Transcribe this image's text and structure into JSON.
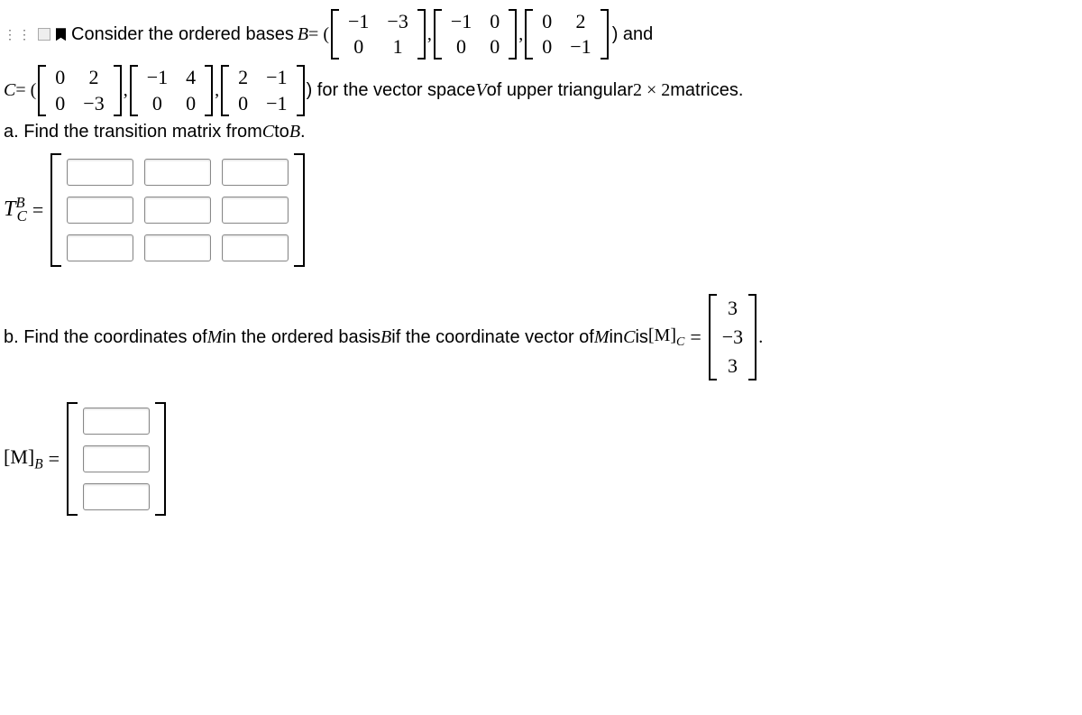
{
  "intro": {
    "lead": "Consider the ordered bases ",
    "B_eq": "B",
    "equals": " = (",
    "and": ") and",
    "matB1": [
      [
        "−1",
        "−3"
      ],
      [
        "0",
        "1"
      ]
    ],
    "matB2": [
      [
        "−1",
        "0"
      ],
      [
        "0",
        "0"
      ]
    ],
    "matB3": [
      [
        "0",
        "2"
      ],
      [
        "0",
        "−1"
      ]
    ]
  },
  "lineC": {
    "C_eq": "C",
    "equals": " = (",
    "matC1": [
      [
        "0",
        "2"
      ],
      [
        "0",
        "−3"
      ]
    ],
    "matC2": [
      [
        "−1",
        "4"
      ],
      [
        "0",
        "0"
      ]
    ],
    "matC3": [
      [
        "2",
        "−1"
      ],
      [
        "0",
        "−1"
      ]
    ],
    "tail1": ") for the vector space ",
    "V": "V",
    "tail2": " of upper triangular ",
    "dim": "2 × 2",
    "tail3": " matrices."
  },
  "partA": {
    "text": "a. Find the transition matrix from ",
    "C": "C",
    "to": " to ",
    "B": "B",
    "dot": "."
  },
  "TBC": {
    "T": "T",
    "sup": "B",
    "sub": "C",
    "eq": " = "
  },
  "partB": {
    "text1": "b. Find the coordinates of ",
    "M": "M",
    "text2": " in the ordered basis ",
    "B": "B",
    "text3": " if the coordinate vector of ",
    "M2": "M",
    "text4": " in ",
    "C": "C",
    "text5": " is ",
    "MC": "[M]",
    "MCsub": "C",
    "eq": " = ",
    "vec": [
      "3",
      "−3",
      "3"
    ],
    "dot": "."
  },
  "MB": {
    "label": "[M]",
    "sub": "B",
    "eq": " = "
  }
}
